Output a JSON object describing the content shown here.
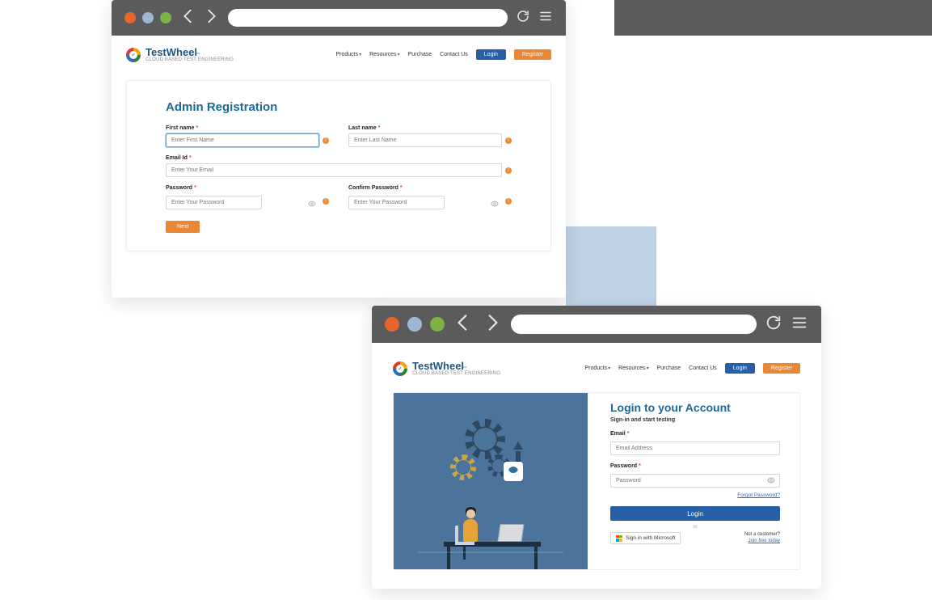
{
  "brand": {
    "name": "TestWheel",
    "tagline": "CLOUD BASED TEST ENGINEERING"
  },
  "nav": {
    "products": "Products",
    "resources": "Resources",
    "purchase": "Purchase",
    "contact": "Contact Us",
    "login": "Login",
    "register": "Register"
  },
  "registration": {
    "title": "Admin Registration",
    "first_name_label": "First name",
    "first_name_placeholder": "Enter First Name",
    "last_name_label": "Last name",
    "last_name_placeholder": "Enter Last Name",
    "email_label": "Email Id",
    "email_placeholder": "Enter Your Email",
    "password_label": "Password",
    "password_placeholder": "Enter Your Password",
    "confirm_password_label": "Confirm Password",
    "confirm_password_placeholder": "Enter Your Password",
    "next_label": "Next"
  },
  "login": {
    "title": "Login to your Account",
    "subtitle": "Sign-in and start testing",
    "email_label": "Email",
    "email_placeholder": "Email Address",
    "password_label": "Password",
    "password_placeholder": "Password",
    "forgot_label": "Forgot Password?",
    "login_button": "Login",
    "or_label": "or",
    "ms_button": "Sign in with Microsoft",
    "not_customer": "Not a customer?",
    "join_free": "Join free today"
  }
}
